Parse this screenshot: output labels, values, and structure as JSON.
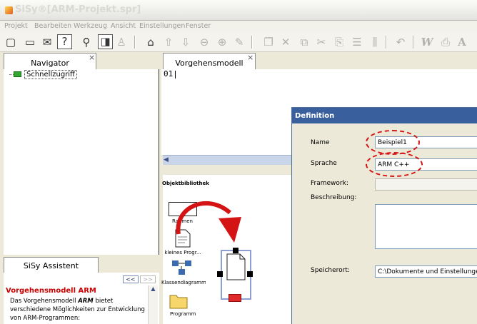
{
  "window": {
    "title": "SiSy®[ARM-Projekt.spr]"
  },
  "menu": [
    {
      "label": "Projekt"
    },
    {
      "label": "Bearbeiten"
    },
    {
      "label": "Werkzeug"
    },
    {
      "label": "Ansicht"
    },
    {
      "label": "Einstellungen"
    },
    {
      "label": "Fenster"
    }
  ],
  "toolbar": {
    "help": "?",
    "search": "⚲",
    "text_w": "W",
    "text_a": "A"
  },
  "navigator": {
    "title": "Navigator",
    "close": "×",
    "tree": [
      {
        "label": "Schnellzugriff"
      }
    ]
  },
  "diagram": {
    "title": "Vorgehensmodell",
    "close": "×",
    "cursor_text": "01"
  },
  "library": {
    "title": "Objektbibliothek",
    "items": [
      {
        "label": "Rahmen"
      },
      {
        "label": "kleines Progr..."
      },
      {
        "label": "Klassendiagramm"
      },
      {
        "label": "Programm"
      }
    ]
  },
  "dialog": {
    "title": "Definition",
    "fields": {
      "name": {
        "label": "Name",
        "value": "Beispiel1"
      },
      "sprache": {
        "label": "Sprache",
        "value": "ARM C++"
      },
      "framework": {
        "label": "Framework:",
        "value": ""
      },
      "beschreibung": {
        "label": "Beschreibung:",
        "value": ""
      },
      "speicherort": {
        "label": "Speicherort:",
        "value": "C:\\Dokumente und Einstellungen\\"
      }
    }
  },
  "assistant": {
    "title": "SiSy Assistent",
    "nav_back": "<<",
    "nav_forward": ">>",
    "heading": "Vorgehensmodell ARM",
    "text_line1_pre": "Das Vorgehensmodell ",
    "text_line1_bold": "ARM",
    "text_line1_post": " bietet",
    "text_line2": "verschiedene Möglichkeiten zur Entwicklung",
    "text_line3": "von ARM-Programmen:"
  },
  "colors": {
    "dialog_title_bg": "#3a5f9d",
    "highlight": "#d41414",
    "assistant_heading": "#cc0000",
    "node_green": "#2fa82f"
  }
}
